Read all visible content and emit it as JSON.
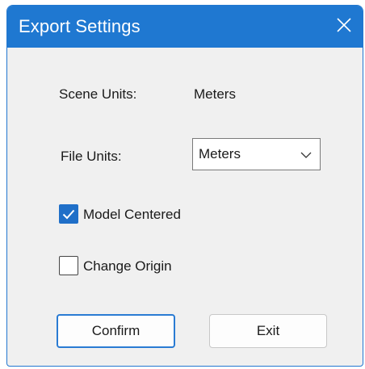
{
  "window": {
    "title": "Export Settings",
    "close_icon": "close-icon",
    "accent_color": "#1f78d1"
  },
  "scene_units": {
    "label": "Scene  Units:",
    "value": "Meters"
  },
  "file_units": {
    "label": "File Units:",
    "selected": "Meters",
    "dropdown_icon": "chevron-down-icon"
  },
  "options": {
    "model_centered": {
      "label": "Model Centered",
      "checked": true
    },
    "change_origin": {
      "label": "Change Origin",
      "checked": false
    }
  },
  "buttons": {
    "confirm_label": "Confirm",
    "exit_label": "Exit"
  }
}
